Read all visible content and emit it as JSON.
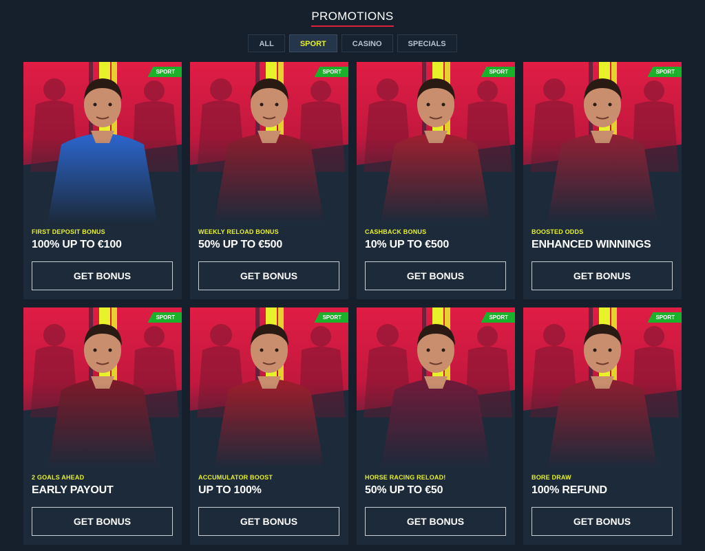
{
  "page": {
    "title": "PROMOTIONS"
  },
  "tabs": [
    {
      "label": "ALL",
      "active": false
    },
    {
      "label": "SPORT",
      "active": true
    },
    {
      "label": "CASINO",
      "active": false
    },
    {
      "label": "SPECIALS",
      "active": false
    }
  ],
  "colors": {
    "background": "#15202c",
    "card": "#1c2a3a",
    "accent_red": "#e0223a",
    "accent_yellow": "#e8f22a",
    "badge_green": "#1bb12a"
  },
  "promotions": [
    {
      "badge": "SPORT",
      "subtitle": "FIRST DEPOSIT BONUS",
      "headline": "100% UP TO €100",
      "button": "GET BONUS",
      "jersey": "#2b63c8"
    },
    {
      "badge": "SPORT",
      "subtitle": "WEEKLY RELOAD BONUS",
      "headline": "50% UP TO €500",
      "button": "GET BONUS",
      "jersey": "#8a1d2e"
    },
    {
      "badge": "SPORT",
      "subtitle": "CASHBACK BONUS",
      "headline": "10% UP TO €500",
      "button": "GET BONUS",
      "jersey": "#9a2030"
    },
    {
      "badge": "SPORT",
      "subtitle": "BOOSTED ODDS",
      "headline": "ENHANCED WINNINGS",
      "button": "GET BONUS",
      "jersey": "#8e2035"
    },
    {
      "badge": "SPORT",
      "subtitle": "2 GOALS AHEAD",
      "headline": "EARLY PAYOUT",
      "button": "GET BONUS",
      "jersey": "#7a1a2a"
    },
    {
      "badge": "SPORT",
      "subtitle": "ACCUMULATOR BOOST",
      "headline": "UP TO 100%",
      "button": "GET BONUS",
      "jersey": "#9b1d2c"
    },
    {
      "badge": "SPORT",
      "subtitle": "HORSE RACING RELOAD!",
      "headline": "50% UP TO €50",
      "button": "GET BONUS",
      "jersey": "#6e1b3a"
    },
    {
      "badge": "SPORT",
      "subtitle": "BORE DRAW",
      "headline": "100% REFUND",
      "button": "GET BONUS",
      "jersey": "#8a1e30"
    }
  ]
}
